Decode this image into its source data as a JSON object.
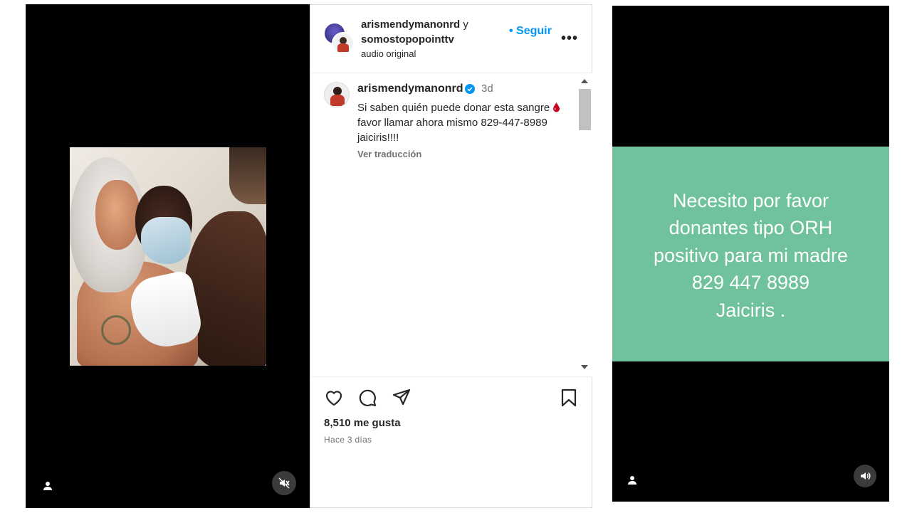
{
  "left_reel": {
    "user_icon": "person-icon",
    "mute_icon": "speaker-muted-icon"
  },
  "post": {
    "author1": "arismendymanonrd",
    "conjunction": "y",
    "author2": "somostopopointtv",
    "audio": "audio original",
    "follow_label": "• Seguir",
    "more_label": "•••",
    "caption": {
      "username": "arismendymanonrd",
      "verified": true,
      "age": "3d",
      "text_before_emoji": "Si saben quién puede donar esta sangre ",
      "emoji": "drop-of-blood-emoji",
      "text_after_emoji": " favor llamar ahora mismo 829-447-8989 jaiciris!!!!",
      "translate_label": "Ver traducción"
    },
    "likes": "8,510 me gusta",
    "date": "Hace 3 días",
    "icons": [
      "heart-icon",
      "comment-icon",
      "share-icon",
      "bookmark-icon"
    ]
  },
  "right_reel": {
    "card_text": "Necesito  por favor\ndonantes tipo ORH\npositivo para  mi madre\n829 447 8989\nJaiciris .",
    "card_color": "#6fc29c",
    "user_icon": "person-icon",
    "sound_icon": "speaker-on-icon"
  },
  "colors": {
    "accent": "#0095f6",
    "verified": "#0095f6",
    "blood": "#c4001a"
  }
}
